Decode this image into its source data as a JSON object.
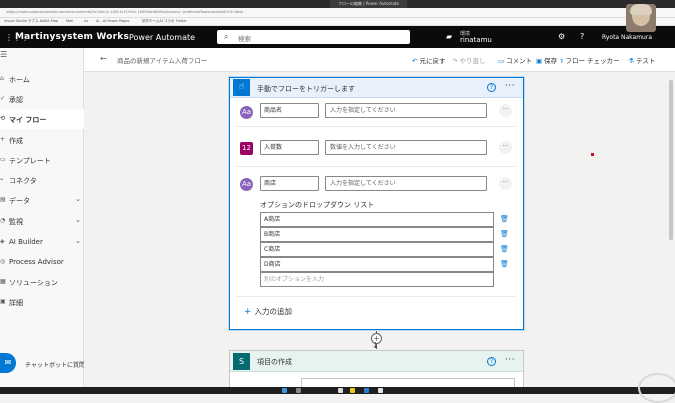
{
  "browser": {
    "tab_title": "フローの編集 | Power Automate",
    "url": "https://make.powerautomate.com/environments/2e7a0c1c-1b0f-4c1f-9c0c-1b994dc4fb0f/solutions/~preferred/flows/new/edit?v3=false",
    "bookmarks": [
      "Visual Studio サブス...",
      "NASA Map",
      "Mail",
      "Az",
      "Ai - AI Power Pages",
      "試作チームAI コラボ",
      "Folder"
    ]
  },
  "topbar": {
    "brand": "Martinysystem Works",
    "product": "Power Automate",
    "search_placeholder": "検索",
    "env_label": "環境",
    "env_name": "rinatamu",
    "user_name": "Ryota Nakamura"
  },
  "sidebar": {
    "items": [
      {
        "icon": "⌂",
        "label": "ホーム",
        "chevron": ""
      },
      {
        "icon": "✓",
        "label": "承認",
        "chevron": ""
      },
      {
        "icon": "⟲",
        "label": "マイ フロー",
        "chevron": ""
      },
      {
        "icon": "+",
        "label": "作成",
        "chevron": ""
      },
      {
        "icon": "▭",
        "label": "テンプレート",
        "chevron": ""
      },
      {
        "icon": "⌁",
        "label": "コネクタ",
        "chevron": ""
      },
      {
        "icon": "▤",
        "label": "データ",
        "chevron": "⌄"
      },
      {
        "icon": "◔",
        "label": "監視",
        "chevron": "⌄"
      },
      {
        "icon": "◈",
        "label": "AI Builder",
        "chevron": "⌄"
      },
      {
        "icon": "◎",
        "label": "Process Advisor",
        "chevron": ""
      },
      {
        "icon": "▦",
        "label": "ソリューション",
        "chevron": ""
      },
      {
        "icon": "▣",
        "label": "詳細",
        "chevron": ""
      }
    ],
    "active_index": 2,
    "chatbot_label": "チャットボットに質問"
  },
  "cmdbar": {
    "flow_title": "商品の新規アイテム入荷フロー",
    "undo": "元に戻す",
    "redo": "やり直し",
    "comment": "コメント",
    "save": "保存",
    "checker": "フロー チェッカー",
    "test": "テスト"
  },
  "trigger_card": {
    "title": "手動でフローをトリガーします",
    "fields": [
      {
        "type_icon": "Aa",
        "color": "#8764b8",
        "name": "商品名",
        "placeholder": "入力を指定してください"
      },
      {
        "type_icon": "12",
        "color": "#9b0062",
        "name": "入荷数",
        "placeholder": "数値を入力してください"
      },
      {
        "type_icon": "Aa",
        "color": "#8764b8",
        "name": "商店",
        "placeholder": "入力を指定してください"
      }
    ],
    "dropdown_label": "オプションのドロップダウン リスト",
    "options": [
      "A商店",
      "B商店",
      "C商店",
      "D商店"
    ],
    "option_placeholder": "別のオプションを入力",
    "add_input": "入力の追加"
  },
  "action_card": {
    "title": "項目の作成"
  },
  "colors": {
    "accent": "#0078d4",
    "topbar": "#0b0b0b",
    "sharepoint": "#036c70"
  }
}
